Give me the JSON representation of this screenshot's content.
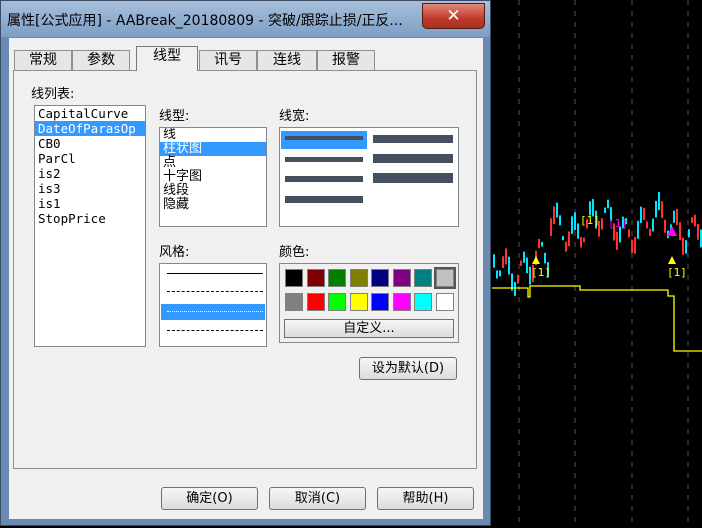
{
  "window": {
    "title": "属性[公式应用] - AABreak_20180809 - 突破/跟踪止损/正反...",
    "close_glyph": "✕"
  },
  "tabs": [
    {
      "label": "常规",
      "active": false
    },
    {
      "label": "参数",
      "active": false
    },
    {
      "label": "线型",
      "active": true
    },
    {
      "label": "讯号",
      "active": false
    },
    {
      "label": "连线",
      "active": false
    },
    {
      "label": "报警",
      "active": false
    }
  ],
  "line_list": {
    "label": "线列表:",
    "items": [
      "CapitalCurve",
      "DateOfParasOp",
      "CB0",
      "ParCl",
      "is2",
      "is3",
      "is1",
      "StopPrice"
    ],
    "selected_index": 1
  },
  "line_type": {
    "label": "线型:",
    "items": [
      "线",
      "柱状图",
      "点",
      "十字图",
      "线段",
      "隐藏"
    ],
    "selected_index": 1
  },
  "line_width": {
    "label": "线宽:"
  },
  "style": {
    "label": "风格:",
    "selected_index": 2
  },
  "color": {
    "label": "颜色:",
    "swatches_row1": [
      "#000000",
      "#800000",
      "#008000",
      "#808000",
      "#000080",
      "#800080",
      "#008080",
      "#c0c0c0"
    ],
    "swatches_row2": [
      "#808080",
      "#ff0000",
      "#00ff00",
      "#ffff00",
      "#0000ff",
      "#ff00ff",
      "#00ffff",
      "#ffffff"
    ],
    "custom_label": "自定义..."
  },
  "set_default_label": "设为默认(D)",
  "buttons": {
    "ok": "确定(O)",
    "cancel": "取消(C)",
    "help": "帮助(H)"
  },
  "chart": {
    "annotations": [
      "[1]",
      "[1]",
      "[1]",
      "[1]"
    ],
    "colors": {
      "up": "#00e5ff",
      "down": "#ff3030",
      "stop_line": "#ffff00",
      "marker": "#ff00ff"
    }
  }
}
